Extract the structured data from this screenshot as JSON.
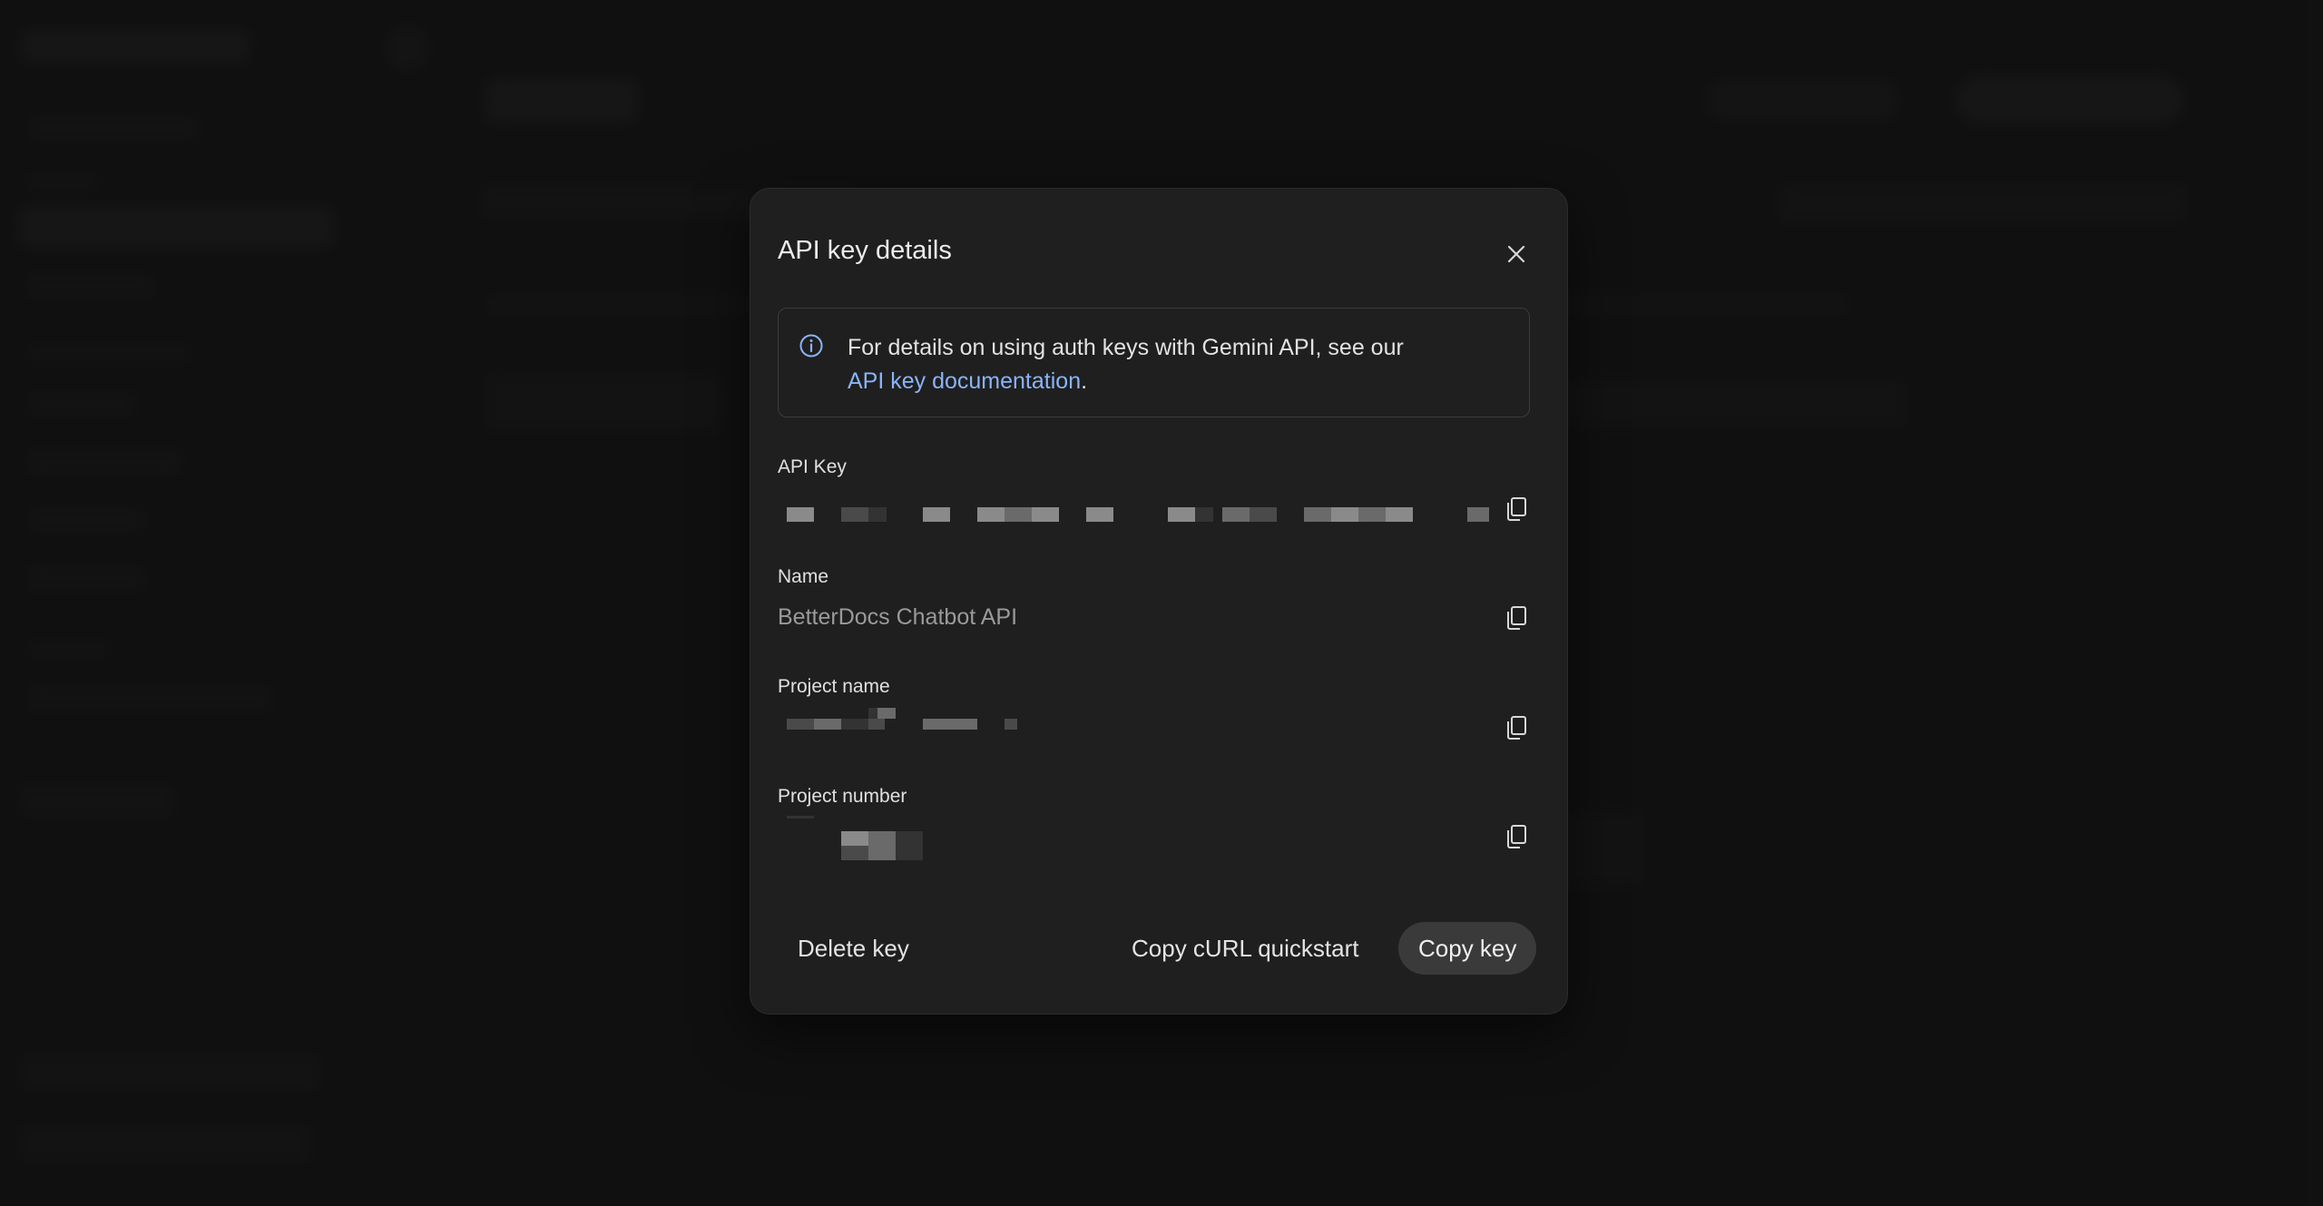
{
  "dialog": {
    "title": "API key details",
    "close_icon": "close-icon",
    "info": {
      "icon": "info-icon",
      "text": "For details on using auth keys with Gemini API, see our",
      "link_text": "API key documentation",
      "suffix": "."
    },
    "fields": {
      "api_key_label": "API Key",
      "name_label": "Name",
      "name_value": "BetterDocs Chatbot API",
      "project_name_label": "Project name",
      "project_number_label": "Project number",
      "copy_icon": "copy-icon"
    },
    "actions": {
      "delete_label": "Delete key",
      "copy_curl_label": "Copy cURL quickstart",
      "copy_key_label": "Copy key"
    }
  },
  "colors": {
    "background": "#1a1a1a",
    "dialog": "#1f1f1f",
    "link": "#8ab4f8",
    "primary_button": "#3a3a3a"
  }
}
